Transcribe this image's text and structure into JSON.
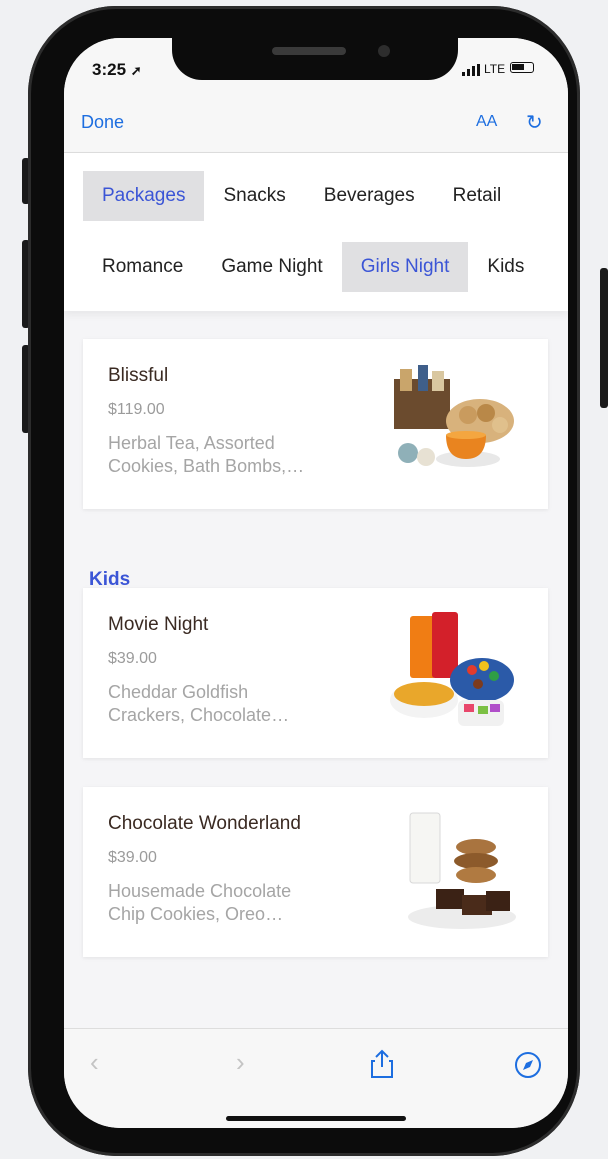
{
  "status": {
    "time": "3:25",
    "carrier": "LTE"
  },
  "safari": {
    "done_label": "Done",
    "text_size_label": "AA"
  },
  "tabs_row1": [
    "Packages",
    "Snacks",
    "Beverages",
    "Retail"
  ],
  "tabs_row2": [
    "Romance",
    "Game Night",
    "Girls Night",
    "Kids"
  ],
  "selected": {
    "row1": "Packages",
    "row2": "Girls Night"
  },
  "cards": [
    {
      "title": "Blissful",
      "price": "$119.00",
      "desc_line1": "Herbal Tea, Assorted",
      "desc_line2": "Cookies, Bath Bombs,…",
      "image": "tea-cookies-basket"
    },
    {
      "title": "Movie Night",
      "price": "$39.00",
      "desc_line1": "Cheddar Goldfish",
      "desc_line2": "Crackers, Chocolate…",
      "image": "soda-snacks"
    },
    {
      "title": "Chocolate Wonderland",
      "price": "$39.00",
      "desc_line1": "Housemade Chocolate",
      "desc_line2": "Chip Cookies, Oreo…",
      "image": "milk-cookies-brownies"
    }
  ],
  "sections": {
    "kids": "Kids"
  },
  "colors": {
    "accent": "#3b55d6",
    "safari_blue": "#1d6ee0"
  }
}
